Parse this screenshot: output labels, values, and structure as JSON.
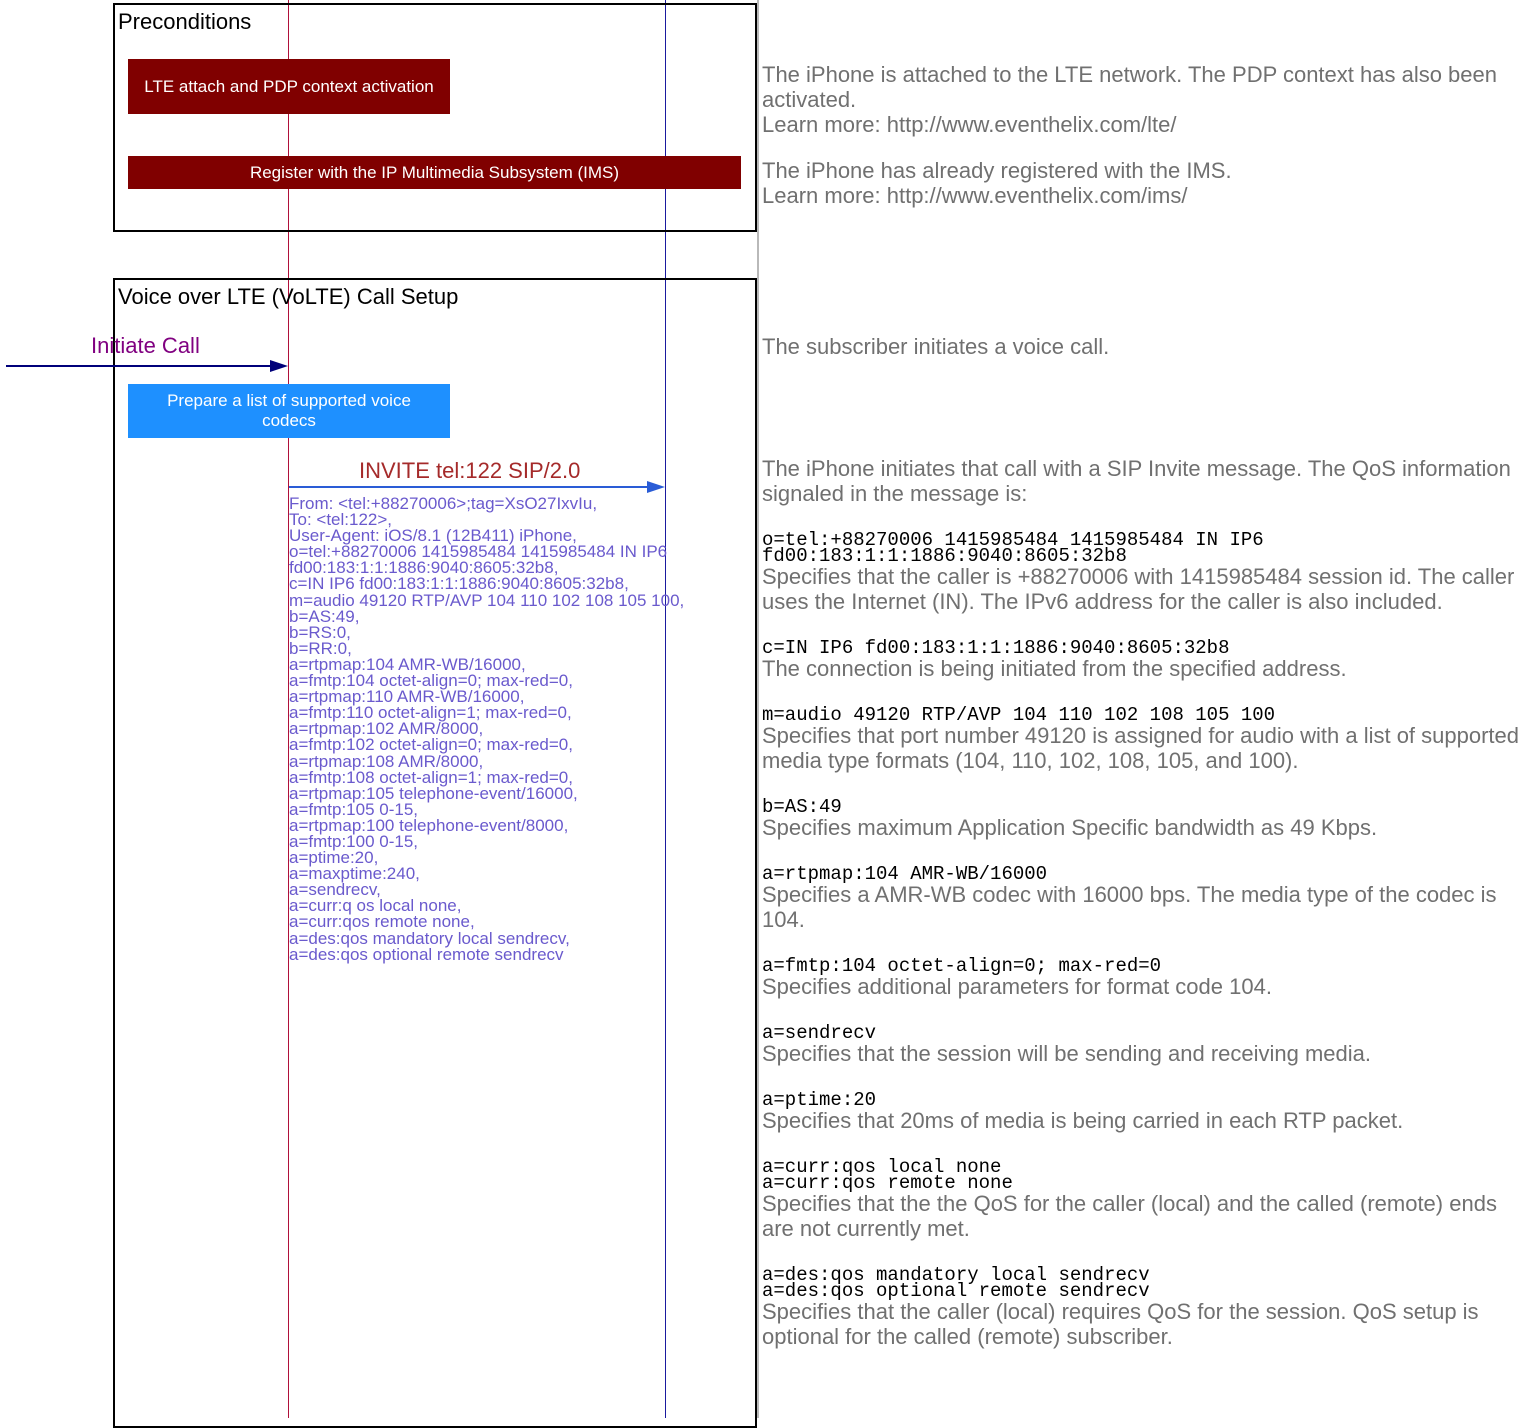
{
  "colors": {
    "lifeline_iphone": "#b0103a",
    "lifeline_network": "#1a1a9e",
    "action_dark_red": "#800000",
    "action_blue": "#1e90ff",
    "message_label": "#a52a2a",
    "message_body": "#6a5acd",
    "external_label": "#800080",
    "arrow": "#2a5cd6",
    "note_text": "#707070"
  },
  "preconditions": {
    "title": "Preconditions",
    "actions": [
      "LTE attach and PDP context activation",
      "Register with the IP Multimedia Subsystem (IMS)"
    ],
    "notes": [
      {
        "lines": [
          "The iPhone is attached to the LTE network. The PDP context has also been activated.",
          "Learn more: http://www.eventhelix.com/lte/"
        ]
      },
      {
        "lines": [
          "The iPhone has already registered with the IMS.",
          "Learn more: http://www.eventhelix.com/ims/"
        ]
      }
    ]
  },
  "call_setup": {
    "title": "Voice over LTE (VoLTE) Call Setup",
    "initiate_call_label": "Initiate Call",
    "initiate_call_note": "The subscriber initiates a voice call.",
    "prepare_codecs_action": "Prepare a list of supported voice codecs",
    "invite": {
      "label": "INVITE tel:122 SIP/2.0",
      "body": [
        "From: <tel:+88270006>;tag=XsO27IxvIu,",
        "To: <tel:122>,",
        "User-Agent: iOS/8.1 (12B411) iPhone,",
        "o=tel:+88270006 1415985484 1415985484 IN IP6",
        "fd00:183:1:1:1886:9040:8605:32b8,",
        "c=IN IP6 fd00:183:1:1:1886:9040:8605:32b8,",
        "m=audio 49120 RTP/AVP 104 110 102 108 105 100,",
        "b=AS:49,",
        "b=RS:0,",
        "b=RR:0,",
        "a=rtpmap:104 AMR-WB/16000,",
        "a=fmtp:104 octet-align=0; max-red=0,",
        "a=rtpmap:110 AMR-WB/16000,",
        "a=fmtp:110 octet-align=1; max-red=0,",
        "a=rtpmap:102 AMR/8000,",
        "a=fmtp:102 octet-align=0; max-red=0,",
        "a=rtpmap:108 AMR/8000,",
        "a=fmtp:108 octet-align=1; max-red=0,",
        "a=rtpmap:105 telephone-event/16000,",
        "a=fmtp:105 0-15,",
        "a=rtpmap:100 telephone-event/8000,",
        "a=fmtp:100 0-15,",
        "a=ptime:20,",
        "a=maxptime:240,",
        "a=sendrecv,",
        "a=curr:q os local none,",
        "a=curr:qos remote none,",
        "a=des:qos mandatory local sendrecv,",
        "a=des:qos optional remote sendrecv"
      ],
      "note_intro": "The iPhone initiates that call with a SIP Invite message. The QoS information signaled in the message is:",
      "explanations": [
        {
          "code": [
            "o=tel:+88270006 1415985484 1415985484 IN IP6",
            "fd00:183:1:1:1886:9040:8605:32b8"
          ],
          "text": "Specifies that the caller is +88270006 with 1415985484 session id. The caller uses the Internet (IN). The IPv6 address for the caller is also included."
        },
        {
          "code": [
            "c=IN IP6 fd00:183:1:1:1886:9040:8605:32b8"
          ],
          "text": "The connection is being initiated from the specified address."
        },
        {
          "code": [
            "m=audio 49120 RTP/AVP 104 110 102 108 105 100"
          ],
          "text": "Specifies that port number 49120 is assigned for audio with a list of supported media type formats (104, 110, 102, 108, 105, and 100)."
        },
        {
          "code": [
            "b=AS:49"
          ],
          "text": "Specifies maximum Application Specific bandwidth as 49 Kbps."
        },
        {
          "code": [
            "a=rtpmap:104 AMR-WB/16000"
          ],
          "text": "Specifies a AMR-WB codec with 16000 bps. The media type of the codec is 104."
        },
        {
          "code": [
            "a=fmtp:104 octet-align=0; max-red=0"
          ],
          "text": "Specifies additional parameters for format code 104."
        },
        {
          "code": [
            "a=sendrecv"
          ],
          "text": "Specifies that the session will be sending and receiving media."
        },
        {
          "code": [
            "a=ptime:20"
          ],
          "text": "Specifies that 20ms of media is being carried in each RTP packet."
        },
        {
          "code": [
            "a=curr:qos local none",
            "a=curr:qos remote none"
          ],
          "text": "Specifies that the the QoS for the caller (local) and the called (remote) ends are not currently met."
        },
        {
          "code": [
            "a=des:qos mandatory local sendrecv",
            "a=des:qos optional remote sendrecv"
          ],
          "text": "Specifies that the caller (local) requires QoS for the session. QoS setup is optional for the called (remote) subscriber."
        }
      ]
    }
  }
}
